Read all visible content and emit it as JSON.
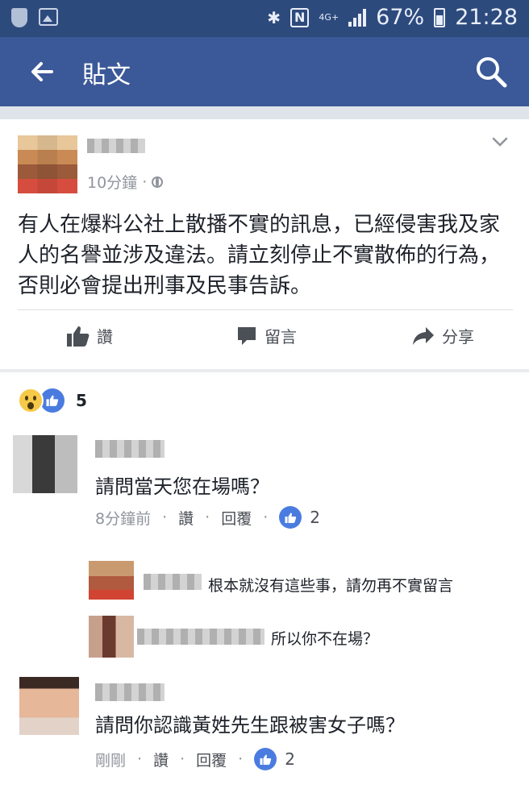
{
  "status_bar": {
    "network": "4G+",
    "battery": "67%",
    "time": "21:28"
  },
  "app_bar": {
    "title": "貼文"
  },
  "post": {
    "time": "10分鐘",
    "body": "有人在爆料公社上散播不實的訊息，已經侵害我及家人的名譽並涉及違法。請立刻停止不實散佈的行為，否則必會提出刑事及民事告訴。",
    "actions": {
      "like": "讚",
      "comment": "留言",
      "share": "分享"
    }
  },
  "reactions": {
    "count": "5"
  },
  "comments": [
    {
      "text": "請問當天您在場嗎？",
      "time": "8分鐘前",
      "like": "讚",
      "reply": "回覆",
      "likes": "2",
      "replies": [
        {
          "text": "根本就沒有這些事，請勿再不實留言"
        },
        {
          "text": "所以你不在場？"
        }
      ]
    },
    {
      "text": "請問你認識黃姓先生跟被害女子嗎？",
      "time": "剛剛",
      "like": "讚",
      "reply": "回覆",
      "likes": "2"
    }
  ],
  "meta_separator": "·",
  "icons": {
    "back": "arrow-left-icon",
    "search": "search-icon",
    "dropdown": "chevron-down-icon",
    "globe": "globe-icon",
    "like": "thumbs-up-icon",
    "comment": "comment-bubble-icon",
    "share": "share-arrow-icon",
    "wow": "wow-reaction-icon",
    "bluetooth": "bluetooth-icon",
    "nfc": "nfc-icon"
  },
  "colors": {
    "status_bar": "#2d4a7d",
    "app_bar": "#3b5998",
    "like_blue": "#4a7ce0",
    "meta_gray": "#90949c"
  }
}
